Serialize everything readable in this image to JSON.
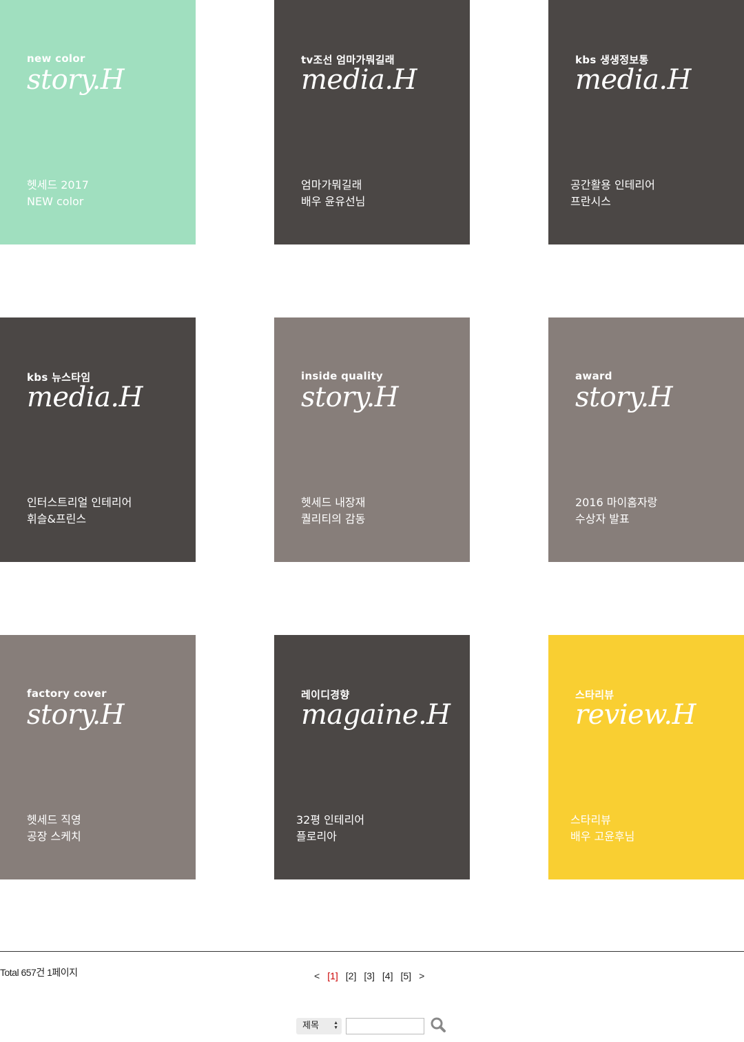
{
  "cards": [
    {
      "category": "new color",
      "script": "story.H",
      "desc_line1": "헷세드 2017",
      "desc_line2": "NEW color",
      "bg": "#a0dfbf"
    },
    {
      "category": "tv조선 엄마가뭐길래",
      "script": "media.H",
      "desc_line1": "엄마가뭐길래",
      "desc_line2": "배우 윤유선님",
      "bg": "#4b4745"
    },
    {
      "category": "kbs 생생정보통",
      "script": "media.H",
      "desc_line1": "공간활용 인테리어",
      "desc_line2": "프란시스",
      "bg": "#4b4745"
    },
    {
      "category": "kbs 뉴스타임",
      "script": "media.H",
      "desc_line1": "인터스트리얼 인테리어",
      "desc_line2": "휘슬&프린스",
      "bg": "#4b4745"
    },
    {
      "category": "inside quality",
      "script": "story.H",
      "desc_line1": "헷세드 내장재",
      "desc_line2": "퀄리티의 감동",
      "bg": "#877e7a"
    },
    {
      "category": "award",
      "script": "story.H",
      "desc_line1": "2016 마이홈자랑",
      "desc_line2": "수상자 발표",
      "bg": "#877e7a"
    },
    {
      "category": "factory cover",
      "script": "story.H",
      "desc_line1": "헷세드 직영",
      "desc_line2": "공장 스케치",
      "bg": "#877e7a"
    },
    {
      "category": "레이디경향",
      "script": "magaine.H",
      "desc_line1": "32평 인테리어",
      "desc_line2": "플로리아",
      "bg": "#4b4745"
    },
    {
      "category": "스타리뷰",
      "script": "review.H",
      "desc_line1": "스타리뷰",
      "desc_line2": "배우 고윤후님",
      "bg": "#f9cf32"
    }
  ],
  "footer": {
    "total": "Total 657건 1페이지"
  },
  "pagination": {
    "prev": "<",
    "pages": [
      "[1]",
      "[2]",
      "[3]",
      "[4]",
      "[5]"
    ],
    "current_page": 1,
    "next": ">",
    "current_color": "#cc0000"
  },
  "search": {
    "select_value": "제목",
    "input_value": "",
    "button_icon": "search-icon"
  }
}
